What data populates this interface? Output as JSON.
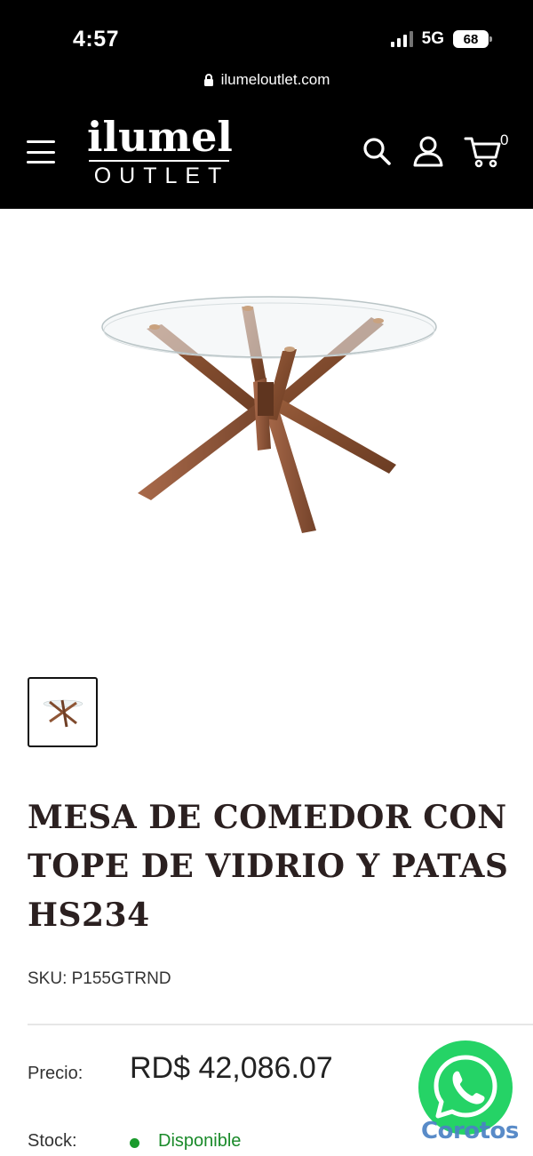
{
  "status_bar": {
    "time": "4:57",
    "network": "5G",
    "battery": "68"
  },
  "browser": {
    "url": "ilumeloutlet.com"
  },
  "header": {
    "logo_top": "ilumel",
    "logo_bottom": "OUTLET",
    "cart_count": "0",
    "icons": [
      "menu-icon",
      "search-icon",
      "user-icon",
      "cart-icon"
    ]
  },
  "product": {
    "title": "MESA DE COMEDOR CON TOPE DE VIDRIO Y PATAS HS234",
    "sku": "SKU: P155GTRND",
    "price_label": "Precio:",
    "price": "RD$ 42,086.07",
    "stock_label": "Stock:",
    "stock_value": "Disponible",
    "stock_color": "#1a9a2c"
  },
  "overlay": {
    "watermark": "Corotos",
    "whatsapp_color": "#25d366"
  }
}
